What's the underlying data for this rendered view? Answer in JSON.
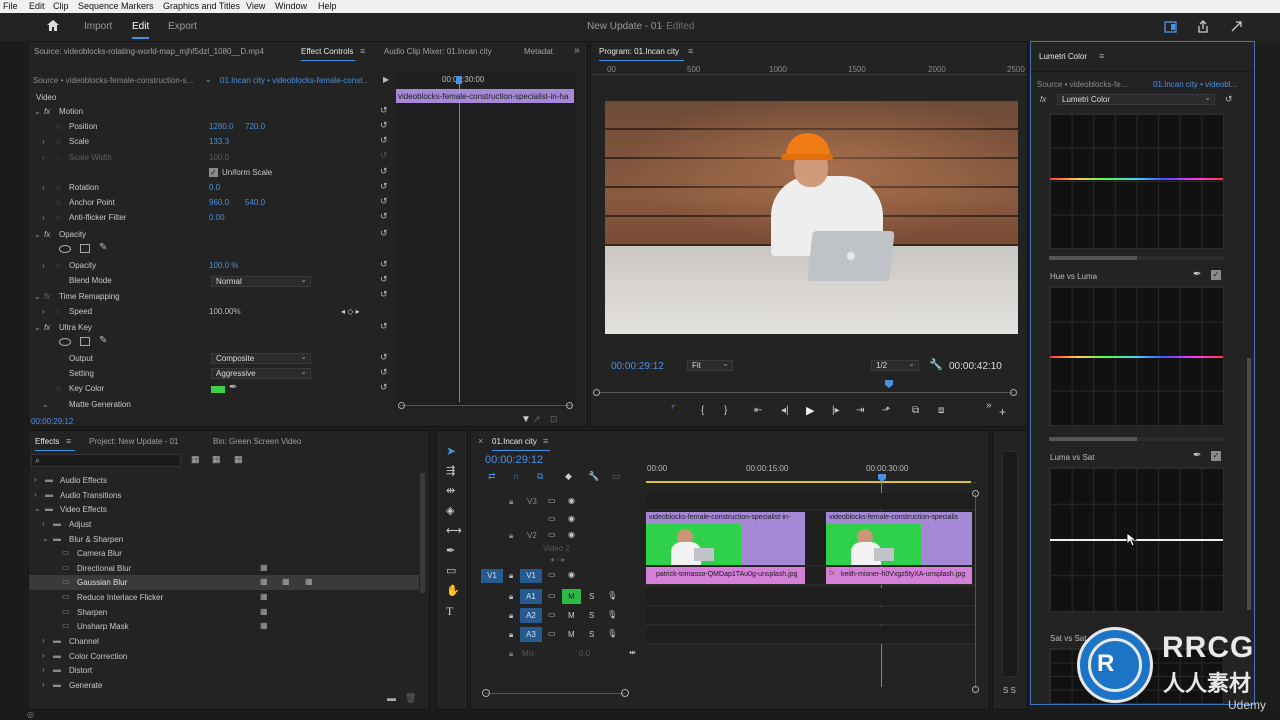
{
  "menubar": {
    "items": [
      "File",
      "Edit",
      "Clip",
      "Sequence",
      "Markers",
      "Graphics and Titles",
      "View",
      "Window",
      "Help"
    ]
  },
  "header": {
    "tabs": [
      "Import",
      "Edit",
      "Export"
    ],
    "active": "Edit",
    "title": "New Update - 01",
    "status": "- Edited"
  },
  "source_panel": {
    "tabs": [
      "Source: videoblocks-rotating-world-map_mjhf5dzl_1080__D.mp4",
      "Effect Controls",
      "Audio Clip Mixer: 01.Incan city",
      "Metadat"
    ],
    "source_label": "Source • videoblocks-female-construction-s...",
    "sequence_label": "01.Incan city • videoblocks-female-const...",
    "ruler_time": "00:00:30:00",
    "clip_name": "videoblocks-female-construction-specialist-in-ha",
    "video_label": "Video",
    "timecode": "00:00:29:12",
    "props": [
      {
        "label": "Motion",
        "v1": "",
        "v2": ""
      },
      {
        "label": "Position",
        "v1": "1280.0",
        "v2": "720.0"
      },
      {
        "label": "Scale",
        "v1": "133.3",
        "v2": ""
      },
      {
        "label": "Scale Width",
        "v1": "100.0",
        "v2": ""
      },
      {
        "label": "Uniform Scale",
        "v1": "",
        "v2": ""
      },
      {
        "label": "Rotation",
        "v1": "0.0",
        "v2": ""
      },
      {
        "label": "Anchor Point",
        "v1": "960.0",
        "v2": "540.0"
      },
      {
        "label": "Anti-flicker Filter",
        "v1": "0.00",
        "v2": ""
      },
      {
        "label": "Opacity",
        "v1": "",
        "v2": ""
      },
      {
        "label": "Opacity",
        "v1": "100.0 %",
        "v2": ""
      },
      {
        "label": "Blend Mode",
        "v1": "Normal",
        "v2": ""
      },
      {
        "label": "Time Remapping",
        "v1": "",
        "v2": ""
      },
      {
        "label": "Speed",
        "v1": "100.00%",
        "v2": ""
      },
      {
        "label": "Ultra Key",
        "v1": "",
        "v2": ""
      },
      {
        "label": "Output",
        "v1": "Composite",
        "v2": ""
      },
      {
        "label": "Setting",
        "v1": "Aggressive",
        "v2": ""
      },
      {
        "label": "Key Color",
        "v1": "",
        "v2": ""
      },
      {
        "label": "Matte Generation",
        "v1": "",
        "v2": ""
      }
    ]
  },
  "program": {
    "title": "Program: 01.Incan city",
    "ruler": [
      "00",
      "500",
      "1000",
      "1500",
      "2000",
      "2500"
    ],
    "timecode": "00:00:29:12",
    "fit": "Fit",
    "res": "1/2",
    "duration": "00:00:42:10"
  },
  "lumetri": {
    "title": "Lumetri Color",
    "source": "Source • videoblocks-fe...",
    "seq": "01.Incan city • videobl...",
    "effect": "Lumetri Color",
    "sections": [
      "Hue vs Luma",
      "Luma vs Sat",
      "Sat vs Sat"
    ]
  },
  "effects_panel": {
    "tabs": [
      "Effects",
      "Project: New Update - 01",
      "Bin: Green Screen Video"
    ],
    "tree": [
      {
        "label": "Audio Effects",
        "level": 0
      },
      {
        "label": "Audio Transitions",
        "level": 0
      },
      {
        "label": "Video Effects",
        "level": 0
      },
      {
        "label": "Adjust",
        "level": 1
      },
      {
        "label": "Blur & Sharpen",
        "level": 1
      },
      {
        "label": "Camera Blur",
        "level": 2
      },
      {
        "label": "Directional Blur",
        "level": 2
      },
      {
        "label": "Gaussian Blur",
        "level": 2
      },
      {
        "label": "Reduce Interlace Flicker",
        "level": 2
      },
      {
        "label": "Sharpen",
        "level": 2
      },
      {
        "label": "Unsharp Mask",
        "level": 2
      },
      {
        "label": "Channel",
        "level": 1
      },
      {
        "label": "Color Correction",
        "level": 1
      },
      {
        "label": "Distort",
        "level": 1
      },
      {
        "label": "Generate",
        "level": 1
      }
    ]
  },
  "timeline": {
    "tab": "01.Incan city",
    "timecode": "00:00:29:12",
    "ruler": [
      "00:00",
      "00:00:15:00",
      "00:00:30:00"
    ],
    "tracks": [
      "V3",
      "V2",
      "V1",
      "A1",
      "A2",
      "A3"
    ],
    "v1_src": "V1",
    "video2_label": "Video 2",
    "mix_label": "Mix",
    "mix_value": "0.0",
    "clips_v2": [
      "videoblocks-female-construction-specialist-in-",
      "videoblocks-female-construction-specialis"
    ],
    "clips_v1": [
      "patrick-tomasso-QMDap1TAu0g-unsplash.jpg",
      "keith-misner-h0Vxgz5tyXA-unsplash.jpg"
    ],
    "btn_m": "M",
    "btn_s": "S"
  },
  "meter": {
    "labels": "S S"
  },
  "watermark": {
    "main": "RRCG",
    "sub": "人人素材",
    "udemy": "Udemy"
  },
  "colors": {
    "accent": "#4a90e2",
    "clip": "#a589d6",
    "green": "#2dbb48",
    "key_color": "#3ecf4a"
  }
}
